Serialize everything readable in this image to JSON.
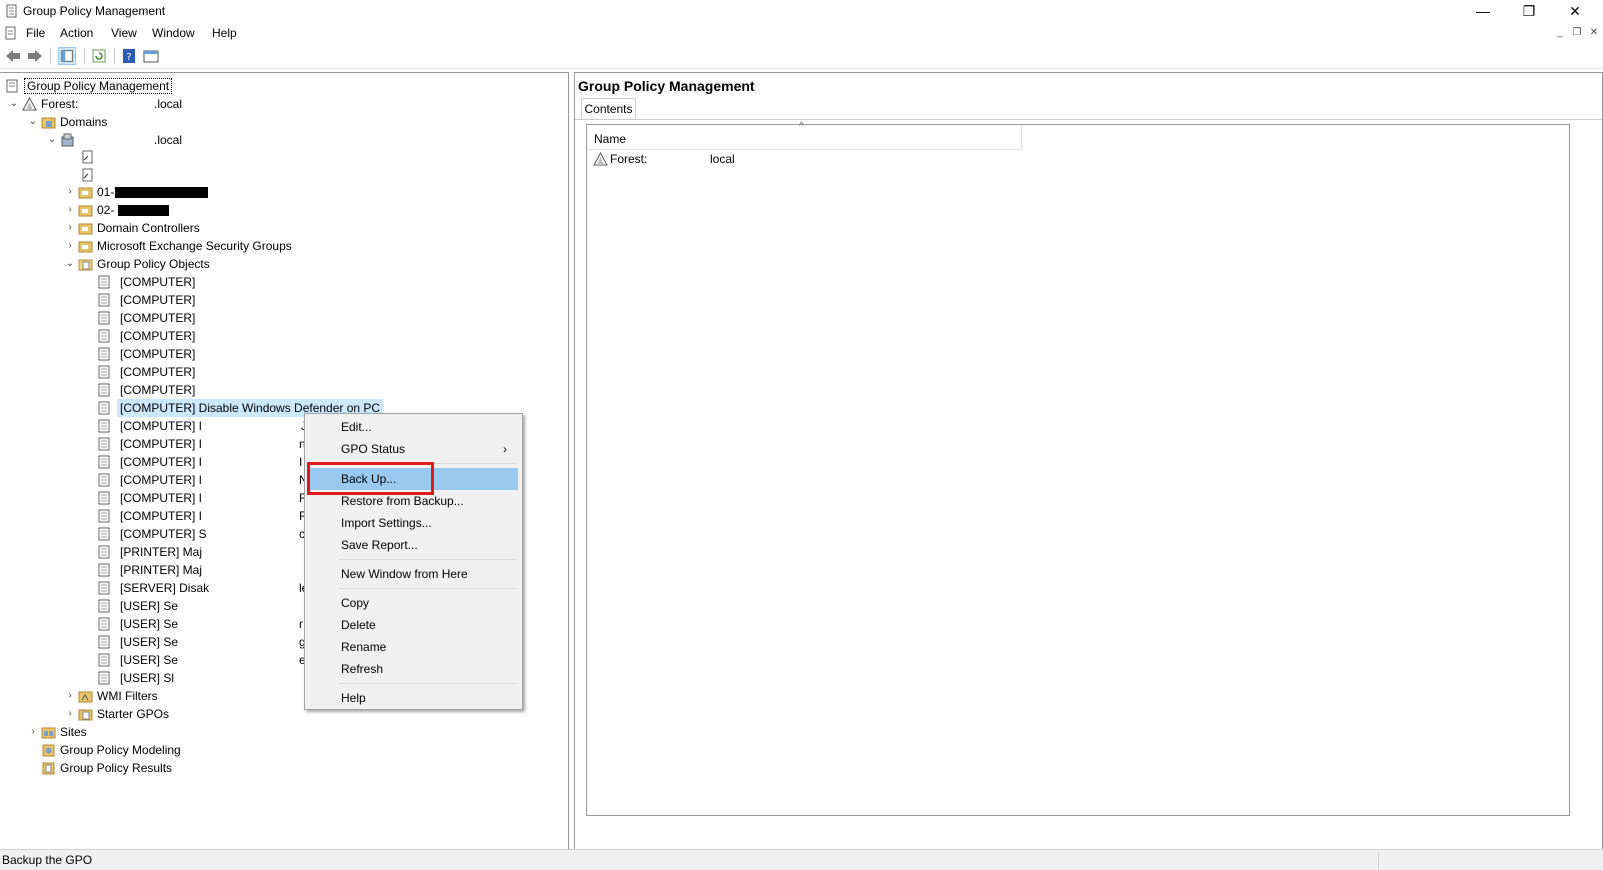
{
  "window": {
    "title": "Group Policy Management",
    "min": "—",
    "restore": "❐",
    "close": "✕"
  },
  "menubar": {
    "file": "File",
    "action": "Action",
    "view": "View",
    "window": "Window",
    "help": "Help",
    "mdi_min": "_",
    "mdi_restore": "❐",
    "mdi_close": "✕"
  },
  "tree": {
    "root": "Group Policy Management",
    "forest_prefix": "Forest:",
    "forest_suffix": ".local",
    "domains": "Domains",
    "domain_suffix": ".local",
    "ou1_prefix": "01-",
    "ou2_prefix": "02-",
    "domain_controllers": "Domain Controllers",
    "exchange_groups": "Microsoft Exchange Security Groups",
    "gpo_container": "Group Policy Objects",
    "gpos": [
      {
        "label": "[COMPUTER]",
        "tail": ""
      },
      {
        "label": "[COMPUTER]",
        "tail": ""
      },
      {
        "label": "[COMPUTER]",
        "tail": ""
      },
      {
        "label": "[COMPUTER]",
        "tail": ""
      },
      {
        "label": "[COMPUTER]",
        "tail": ""
      },
      {
        "label": "[COMPUTER]",
        "tail": ""
      },
      {
        "label": "[COMPUTER]",
        "tail": ""
      },
      {
        "label": "[COMPUTER] Disable Windows Defender on PC",
        "tail": ""
      },
      {
        "label": "[COMPUTER] I",
        "tail": "J"
      },
      {
        "label": "[COMPUTER] I",
        "tail": "n"
      },
      {
        "label": "[COMPUTER] I",
        "tail": "I"
      },
      {
        "label": "[COMPUTER] I",
        "tail": "N"
      },
      {
        "label": "[COMPUTER] I",
        "tail": "R"
      },
      {
        "label": "[COMPUTER] I",
        "tail": "R"
      },
      {
        "label": "[COMPUTER] S",
        "tail": "c"
      },
      {
        "label": "[PRINTER] Maj",
        "tail": ""
      },
      {
        "label": "[PRINTER] Maj",
        "tail": ""
      },
      {
        "label": "[SERVER] Disak",
        "tail": "le"
      },
      {
        "label": "[USER] Sе",
        "tail": ""
      },
      {
        "label": "[USER] Sе",
        "tail": "r"
      },
      {
        "label": "[USER] Sе",
        "tail": "g"
      },
      {
        "label": "[USER] Sе",
        "tail": "e"
      },
      {
        "label": "[USER] Sl",
        "tail": ""
      }
    ],
    "wmi_filters": "WMI Filters",
    "starter_gpos": "Starter GPOs",
    "sites": "Sites",
    "modeling": "Group Policy Modeling",
    "results": "Group Policy Results"
  },
  "right_pane": {
    "title": "Group Policy Management",
    "tab": "Contents",
    "column_name": "Name",
    "row_prefix": "Forest:",
    "row_value": "local"
  },
  "context_menu": {
    "items": [
      "Edit...",
      "GPO Status",
      "Back Up...",
      "Restore from Backup...",
      "Import Settings...",
      "Save Report...",
      "New Window from Here",
      "Copy",
      "Delete",
      "Rename",
      "Refresh",
      "Help"
    ],
    "submenu_arrow": "›",
    "highlighted": "Back Up...",
    "highlight_color": "#99c9ef",
    "annotation_color": "#e0191c"
  },
  "status_bar": {
    "text": "Backup the GPO"
  }
}
